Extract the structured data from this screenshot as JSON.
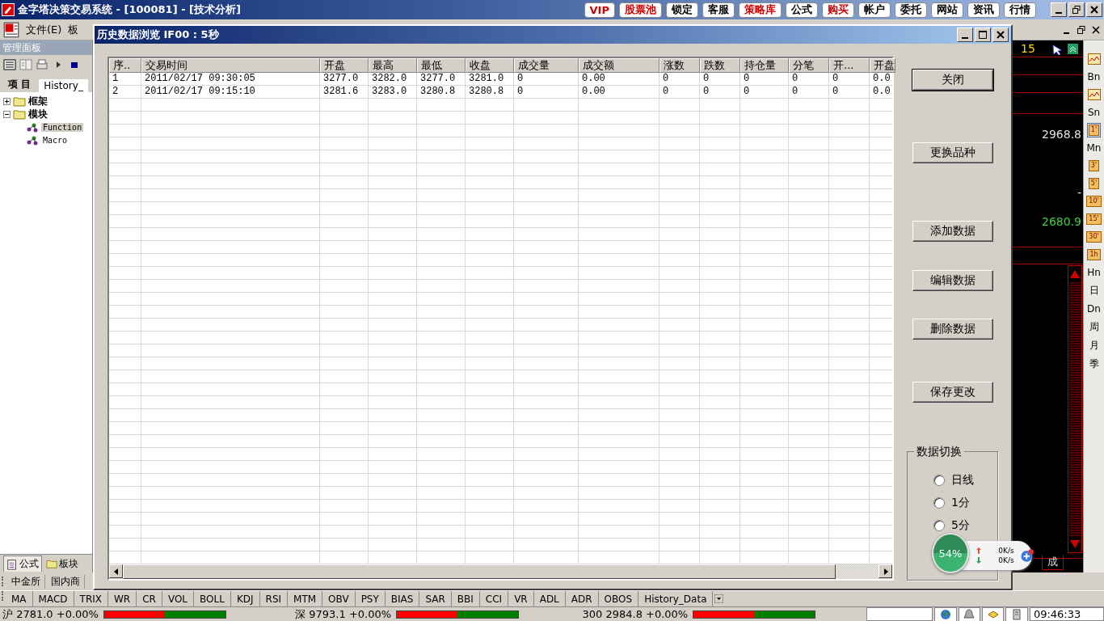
{
  "app_title": "金字塔决策交易系统 - [100081] - [技术分析]",
  "top_buttons": [
    {
      "label": "VIP",
      "color": "#cc0000"
    },
    {
      "label": "股票池",
      "color": "#cc0000"
    },
    {
      "label": "锁定",
      "color": "#000000"
    },
    {
      "label": "客服",
      "color": "#000000"
    },
    {
      "label": "策略库",
      "color": "#cc0000"
    },
    {
      "label": "公式",
      "color": "#000000"
    },
    {
      "label": "购买",
      "color": "#cc0000"
    },
    {
      "label": "帐户",
      "color": "#000000"
    },
    {
      "label": "委托",
      "color": "#000000"
    },
    {
      "label": "网站",
      "color": "#000000"
    },
    {
      "label": "资讯",
      "color": "#000000"
    },
    {
      "label": "行情",
      "color": "#000000"
    }
  ],
  "menu": [
    "文件(E)",
    "板"
  ],
  "left_panel": {
    "title": "管理面板",
    "tabs": [
      {
        "label": "项 目",
        "selected": false
      },
      {
        "label": "History_",
        "selected": true
      }
    ],
    "tree": [
      {
        "label": "框架",
        "expanded": false
      },
      {
        "label": "模块",
        "expanded": true,
        "children": [
          {
            "label": "Function",
            "selected": true
          },
          {
            "label": "Macro",
            "selected": false
          }
        ]
      }
    ],
    "bottom_tabs": [
      {
        "label": "公式",
        "selected": true
      },
      {
        "label": "板块",
        "selected": false
      }
    ]
  },
  "exchange_tabs": [
    "中金所",
    "国内商"
  ],
  "indicator_tabs": [
    "MA",
    "MACD",
    "TRIX",
    "WR",
    "CR",
    "VOL",
    "BOLL",
    "KDJ",
    "RSI",
    "MTM",
    "OBV",
    "PSY",
    "BIAS",
    "SAR",
    "BBI",
    "CCI",
    "VR",
    "ADL",
    "ADR",
    "OBOS",
    "History_Data"
  ],
  "status": {
    "indices": [
      {
        "label": "沪 2781.0 +0.00%",
        "level": 0.5
      },
      {
        "label": "深 9793.1 +0.00%",
        "level": 0.5
      },
      {
        "label": "300 2984.8 +0.00%",
        "level": 0.5
      }
    ],
    "time": "09:46:33"
  },
  "chart": {
    "period": "15",
    "price_high": "2968.8",
    "price_mid": "-",
    "price_low": "2680.9",
    "volume_tab": "成"
  },
  "period_toolbar": [
    {
      "kind": "icon",
      "selected": false
    },
    {
      "kind": "text",
      "label": "Bn",
      "selected": false
    },
    {
      "kind": "icon",
      "selected": false
    },
    {
      "kind": "text",
      "label": "Sn",
      "selected": false
    },
    {
      "kind": "badge",
      "label": "1'",
      "selected": true
    },
    {
      "kind": "text",
      "label": "Mn",
      "selected": false
    },
    {
      "kind": "badge",
      "label": "3'",
      "selected": false
    },
    {
      "kind": "badge",
      "label": "5'",
      "selected": false
    },
    {
      "kind": "badge",
      "label": "10'",
      "selected": false
    },
    {
      "kind": "badge",
      "label": "15'",
      "selected": false
    },
    {
      "kind": "badge",
      "label": "30'",
      "selected": false
    },
    {
      "kind": "badge",
      "label": "1h",
      "selected": false
    },
    {
      "kind": "text",
      "label": "Hn",
      "selected": false
    },
    {
      "kind": "text",
      "label": "日",
      "selected": false
    },
    {
      "kind": "text",
      "label": "Dn",
      "selected": false
    },
    {
      "kind": "text",
      "label": "周",
      "selected": false
    },
    {
      "kind": "text",
      "label": "月",
      "selected": false
    },
    {
      "kind": "text",
      "label": "季",
      "selected": false
    }
  ],
  "dialog": {
    "title": "历史数据浏览 IF00 : 5秒",
    "table": {
      "columns": [
        "序..",
        "交易时间",
        "开盘",
        "最高",
        "最低",
        "收盘",
        "成交量",
        "成交额",
        "涨数",
        "跌数",
        "持仓量",
        "分笔",
        "开...",
        "开盘"
      ],
      "rows": [
        [
          "1",
          "2011/02/17 09:30:05",
          "3277.0",
          "3282.0",
          "3277.0",
          "3281.0",
          "0",
          "0.00",
          "0",
          "0",
          "0",
          "0",
          "0",
          "0.0"
        ],
        [
          "2",
          "2011/02/17 09:15:10",
          "3281.6",
          "3283.0",
          "3280.8",
          "3280.8",
          "0",
          "0.00",
          "0",
          "0",
          "0",
          "0",
          "0",
          "0.0"
        ]
      ]
    },
    "buttons": [
      "关闭",
      "更换品种",
      "添加数据",
      "编辑数据",
      "删除数据",
      "保存更改"
    ],
    "group": {
      "title": "数据切换",
      "options": [
        {
          "label": "日线",
          "selected": false
        },
        {
          "label": "1分",
          "selected": false
        },
        {
          "label": "5分",
          "selected": false
        }
      ]
    }
  },
  "net_widget": {
    "percent": "54%",
    "upload": "0K/s",
    "download": "0K/s"
  }
}
